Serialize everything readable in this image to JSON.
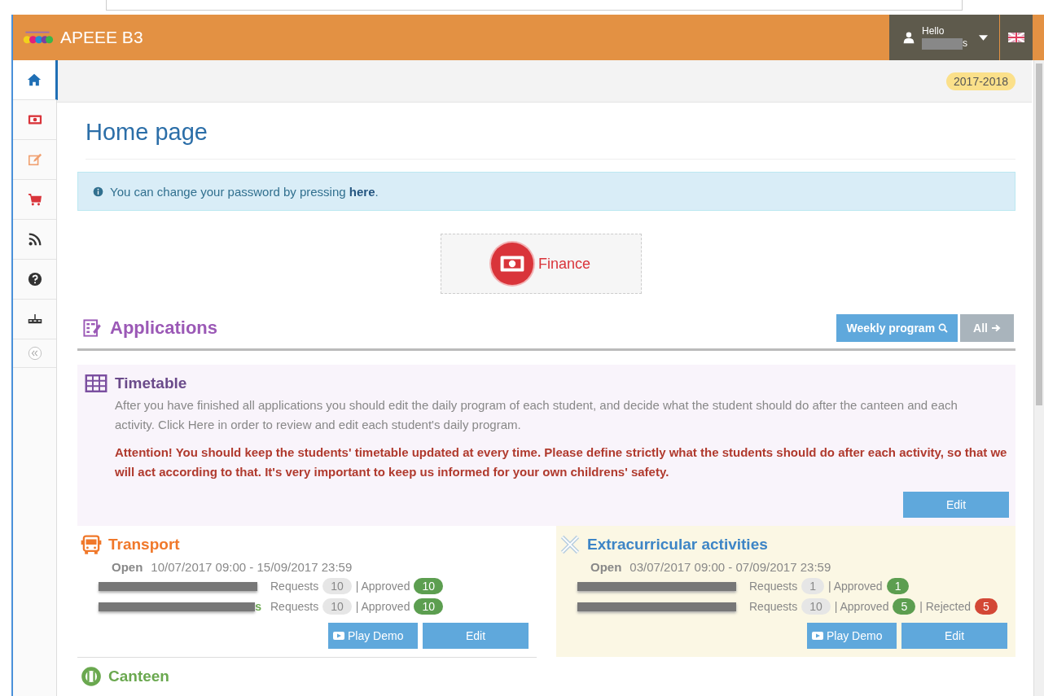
{
  "header": {
    "title": "APEEE B3",
    "user": {
      "greeting": "Hello",
      "name_fragment": "s"
    }
  },
  "sidebar": {
    "items": [
      {
        "kind": "home",
        "selected": true
      },
      {
        "kind": "finance",
        "selected": false
      },
      {
        "kind": "edit",
        "selected": false
      },
      {
        "kind": "cart",
        "selected": false
      },
      {
        "kind": "feed",
        "selected": false
      },
      {
        "kind": "help",
        "selected": false
      },
      {
        "kind": "board",
        "selected": false
      },
      {
        "kind": "collapse",
        "selected": false
      }
    ]
  },
  "year_badge": "2017-2018",
  "page_title": "Home page",
  "alert": {
    "text": "You can change your password by pressing ",
    "link": "here",
    "end": "."
  },
  "shortcut": {
    "label": "Finance"
  },
  "applications": {
    "title": "Applications",
    "buttons": [
      {
        "kind": "search",
        "label": "Weekly program"
      },
      {
        "kind": "arrow",
        "label": "All"
      }
    ]
  },
  "timetable": {
    "title": "Timetable",
    "description": "After you have finished all applications you should edit the daily program of each student, and decide what the student should do after the canteen and each activity. Click Here in order to review and edit each student's daily program.",
    "warning": "Attention! You should keep the students' timetable updated at every time. Please define strictly what the students should do after each activity, so that we will act according to that. It's very important to keep us informed for your own childrens' safety.",
    "button": "Edit"
  },
  "modules": [
    {
      "kind": "transport",
      "title": "Transport",
      "status": "Open",
      "period": "10/07/2017 09:00 - 15/09/2017 23:59",
      "rows": [
        {
          "stats": [
            {
              "label": "Requests",
              "count": "10",
              "color": "#e6e6e6"
            },
            {
              "label": "| Approved",
              "count": "10",
              "color": "#5c9e50"
            }
          ]
        },
        {
          "name_fragment": "s",
          "stats": [
            {
              "label": "Requests",
              "count": "10",
              "color": "#e6e6e6"
            },
            {
              "label": "| Approved",
              "count": "10",
              "color": "#5c9e50"
            }
          ]
        }
      ],
      "buttons": [
        {
          "kind": "demo",
          "label": "Play Demo"
        },
        {
          "kind": "edit",
          "label": "Edit"
        }
      ]
    },
    {
      "kind": "activities",
      "title": "Extracurricular activities",
      "status": "Open",
      "period": "03/07/2017 09:00 - 07/09/2017 23:59",
      "rows": [
        {
          "stats": [
            {
              "label": "Requests",
              "count": "1",
              "color": "#e6e6e6"
            },
            {
              "label": "| Approved",
              "count": "1",
              "color": "#5c9e50"
            }
          ]
        },
        {
          "stats": [
            {
              "label": "Requests",
              "count": "10",
              "color": "#e6e6e6"
            },
            {
              "label": "| Approved",
              "count": "5",
              "color": "#5c9e50"
            },
            {
              "label": "| Rejected",
              "count": "5",
              "color": "#d34836"
            }
          ]
        }
      ],
      "buttons": [
        {
          "kind": "demo",
          "label": "Play Demo"
        },
        {
          "kind": "edit",
          "label": "Edit"
        }
      ]
    },
    {
      "kind": "canteen",
      "title": "Canteen"
    }
  ]
}
